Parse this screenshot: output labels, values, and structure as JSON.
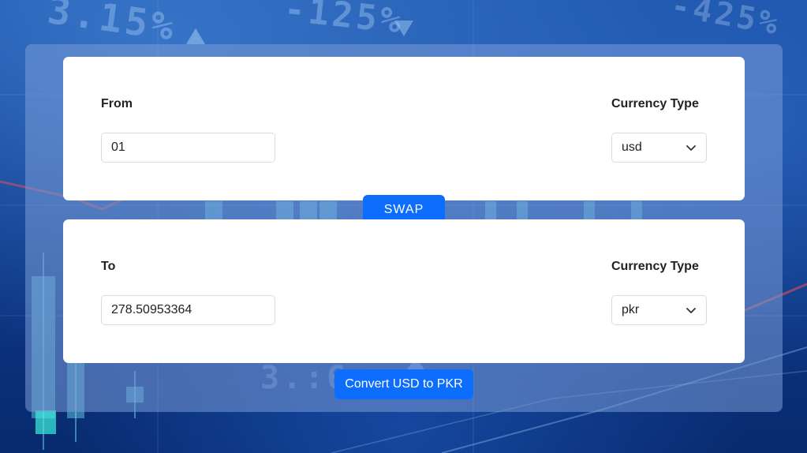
{
  "from_card": {
    "label": "From",
    "amount_value": "01",
    "currency_label": "Currency Type",
    "currency_selected": "usd"
  },
  "swap_button": {
    "label": "SWAP"
  },
  "to_card": {
    "label": "To",
    "amount_value": "278.50953364",
    "currency_label": "Currency Type",
    "currency_selected": "pkr"
  },
  "convert_button": {
    "label": "Convert USD to PKR"
  },
  "colors": {
    "accent": "#0d6efd",
    "card": "#ffffff",
    "panel": "#7e9bd7"
  },
  "icons": {
    "select_arrow": "chevron-down-icon"
  }
}
